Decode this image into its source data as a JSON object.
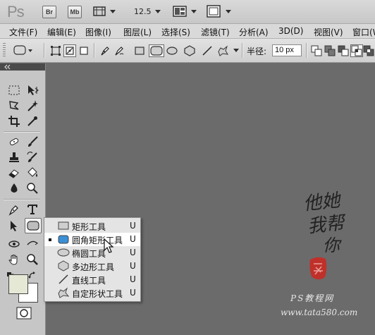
{
  "app": {
    "logo": "Ps",
    "zoom": "12.5",
    "bridge": "Br",
    "minibridge": "Mb"
  },
  "menubar": {
    "items": [
      "文件(F)",
      "编辑(E)",
      "图像(I)",
      "图层(L)",
      "选择(S)",
      "滤镜(T)",
      "分析(A)",
      "3D(D)",
      "视图(V)",
      "窗口(W)"
    ]
  },
  "options": {
    "radius_label": "半径:",
    "radius_value": "10 px"
  },
  "flyout": {
    "items": [
      {
        "label": "矩形工具",
        "key": "U",
        "icon": "rectangle-icon"
      },
      {
        "label": "圆角矩形工具",
        "key": "U",
        "icon": "rounded-rectangle-icon",
        "selected": true
      },
      {
        "label": "椭圆工具",
        "key": "U",
        "icon": "ellipse-icon"
      },
      {
        "label": "多边形工具",
        "key": "U",
        "icon": "polygon-icon"
      },
      {
        "label": "直线工具",
        "key": "U",
        "icon": "line-icon"
      },
      {
        "label": "自定形状工具",
        "key": "U",
        "icon": "custom-shape-icon"
      }
    ]
  },
  "colors": {
    "canvas": "#6b6b6b",
    "foreground": "#e6e8d6",
    "background": "#ffffff",
    "seal": "#c0302a"
  },
  "watermark": {
    "line1": "他她",
    "line2": "我帮",
    "line3": "你",
    "ps_label": "PS教程网",
    "url": "www.tata580.com"
  }
}
